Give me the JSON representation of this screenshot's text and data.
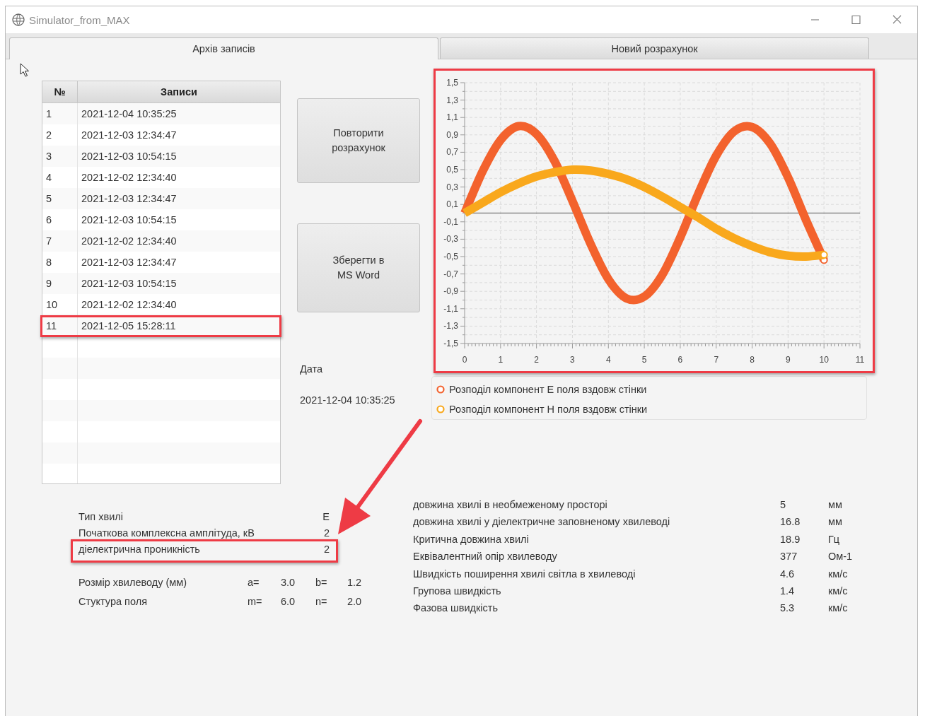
{
  "window": {
    "title": "Simulator_from_MAX"
  },
  "tabs": [
    {
      "label": "Архів записів",
      "selected": true
    },
    {
      "label": "Новий розрахунок",
      "selected": false
    }
  ],
  "table": {
    "columns": [
      "№",
      "Записи"
    ],
    "rows": [
      {
        "number": "1",
        "date": "2021-12-04 10:35:25"
      },
      {
        "number": "2",
        "date": "2021-12-03 12:34:47"
      },
      {
        "number": "3",
        "date": "2021-12-03 10:54:15"
      },
      {
        "number": "4",
        "date": "2021-12-02 12:34:40"
      },
      {
        "number": "5",
        "date": "2021-12-03 12:34:47"
      },
      {
        "number": "6",
        "date": "2021-12-03 10:54:15"
      },
      {
        "number": "7",
        "date": "2021-12-02 12:34:40"
      },
      {
        "number": "8",
        "date": "2021-12-03 12:34:47"
      },
      {
        "number": "9",
        "date": "2021-12-03 10:54:15"
      },
      {
        "number": "10",
        "date": "2021-12-02 12:34:40"
      },
      {
        "number": "11",
        "date": "2021-12-05 15:28:11"
      }
    ]
  },
  "buttons": [
    "Повторити розрахунок",
    "Зберегти в MS Word"
  ],
  "date": {
    "label": "Дата",
    "value": "2021-12-04 10:35:25"
  },
  "chart": {
    "chart_data": {
      "type": "line",
      "x": [
        0,
        0.5,
        1,
        1.5,
        2,
        2.5,
        3,
        3.5,
        4,
        4.5,
        5,
        5.5,
        6,
        6.5,
        7,
        7.5,
        8,
        8.5,
        9,
        9.5,
        10
      ],
      "series": [
        {
          "name": "Розподіл компонент Е поля вздовж стінки",
          "color": "#f3622d",
          "values": [
            0,
            0.48,
            0.84,
            1.0,
            0.91,
            0.6,
            0.14,
            -0.35,
            -0.76,
            -0.98,
            -0.96,
            -0.71,
            -0.28,
            0.22,
            0.66,
            0.94,
            0.99,
            0.8,
            0.41,
            -0.08,
            -0.54
          ]
        },
        {
          "name": "Розподіл компонент Н поля вздовж стінки",
          "color": "#f9a81c",
          "values": [
            0,
            0.12,
            0.24,
            0.34,
            0.42,
            0.47,
            0.5,
            0.49,
            0.45,
            0.39,
            0.3,
            0.19,
            0.07,
            -0.05,
            -0.18,
            -0.29,
            -0.38,
            -0.45,
            -0.49,
            -0.5,
            -0.48
          ]
        }
      ],
      "xlim": [
        0,
        11
      ],
      "ylim": [
        -1.5,
        1.5
      ],
      "grid": true,
      "xticks": [
        0,
        1,
        2,
        3,
        4,
        5,
        6,
        7,
        8,
        9,
        10,
        11
      ],
      "yticks": [
        {
          "value": 1.5,
          "label": "1,5"
        },
        {
          "value": 1.3,
          "label": "1,3"
        },
        {
          "value": 1.1,
          "label": "1,1"
        },
        {
          "value": 0.9,
          "label": "0,9"
        },
        {
          "value": 0.7,
          "label": "0,7"
        },
        {
          "value": 0.5,
          "label": "0,5"
        },
        {
          "value": 0.3,
          "label": "0,3"
        },
        {
          "value": 0.1,
          "label": "0,1"
        },
        {
          "value": -0.1,
          "label": "-0,1"
        },
        {
          "value": -0.3,
          "label": "-0,3"
        },
        {
          "value": -0.5,
          "label": "-0,5"
        },
        {
          "value": -0.7,
          "label": "-0,7"
        },
        {
          "value": -0.9,
          "label": "-0,9"
        },
        {
          "value": -1.1,
          "label": "-1,1"
        },
        {
          "value": -1.3,
          "label": "-1,3"
        },
        {
          "value": -1.5,
          "label": "-1,5"
        }
      ]
    }
  },
  "parameters": [
    {
      "label": "Тип хвилі",
      "value": "E"
    },
    {
      "label": "Початкова комплексна амплітуда,  кВ",
      "value": "2"
    },
    {
      "label": "діелектрична проникність",
      "value": "2"
    }
  ],
  "waveguide": [
    {
      "label": "Розмір хвилеводу (мм)",
      "first_name": "a=",
      "first_value": "3.0",
      "second_name": "b=",
      "second_value": "1.2"
    },
    {
      "label": "Стуктура  поля",
      "first_name": "m=",
      "first_value": "6.0",
      "second_name": "n=",
      "second_value": "2.0"
    }
  ],
  "results": [
    {
      "label": "довжина хвилі в необмеженому просторі",
      "value": "5",
      "unit": "мм"
    },
    {
      "label": "довжина хвилі у діелектричне заповненому хвилеводі",
      "value": "16.8",
      "unit": "мм"
    },
    {
      "label": "Критична довжина хвилі",
      "value": "18.9",
      "unit": "Гц"
    },
    {
      "label": "Еквівалентний опір хвилеводу",
      "value": "377",
      "unit": "Ом-1"
    },
    {
      "label": "Швидкість  поширення хвилі світла в хвилеводі",
      "value": "4.6",
      "unit": "км/с"
    },
    {
      "label": "Групова швидкість",
      "value": "1.4",
      "unit": "км/с"
    },
    {
      "label": "Фазова швидкість",
      "value": "5.3",
      "unit": "км/с"
    }
  ]
}
